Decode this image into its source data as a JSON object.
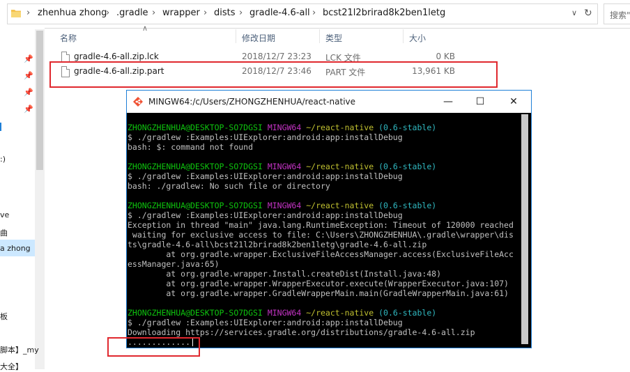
{
  "explorer": {
    "breadcrumbs": [
      "zhenhua zhong",
      ".gradle",
      "wrapper",
      "dists",
      "gradle-4.6-all",
      "bcst21l2brirad8k2ben1letg"
    ],
    "search_placeholder": "搜索\"",
    "columns": {
      "name": "名称",
      "modified": "修改日期",
      "type": "类型",
      "size": "大小"
    },
    "files": [
      {
        "name": "gradle-4.6-all.zip.lck",
        "modified": "2018/12/7 23:23",
        "type": "LCK 文件",
        "size": "0 KB"
      },
      {
        "name": "gradle-4.6-all.zip.part",
        "modified": "2018/12/7 23:46",
        "type": "PART 文件",
        "size": "13,961 KB"
      }
    ],
    "nav_fragments": [
      ":)",
      "ve",
      "曲",
      "a zhong",
      "板",
      "脚本】_my",
      "大全】"
    ]
  },
  "terminal": {
    "title": "MINGW64:/c/Users/ZHONGZHENHUA/react-native",
    "prompt": {
      "user": "ZHONGZHENHUA@DESKTOP-SO7DGSI",
      "env": "MINGW64",
      "path": "~/react-native",
      "branch": "(0.6-stable)"
    },
    "blocks": [
      {
        "command": "$ ./gradlew :Examples:UIExplorer:android:app:installDebug",
        "output": [
          "bash: $: command not found"
        ]
      },
      {
        "command": "$ ./gradlew :Examples:UIExplorer:android:app:installDebug",
        "output": [
          "bash: ./gradlew: No such file or directory"
        ]
      },
      {
        "command": "$ ./gradlew :Examples:UIExplorer:android:app:installDebug",
        "output": [
          "Exception in thread \"main\" java.lang.RuntimeException: Timeout of 120000 reached",
          " waiting for exclusive access to file: C:\\Users\\ZHONGZHENHUA\\.gradle\\wrapper\\dis",
          "ts\\gradle-4.6-all\\bcst21l2brirad8k2ben1letg\\gradle-4.6-all.zip",
          "        at org.gradle.wrapper.ExclusiveFileAccessManager.access(ExclusiveFileAcc",
          "essManager.java:65)",
          "        at org.gradle.wrapper.Install.createDist(Install.java:48)",
          "        at org.gradle.wrapper.WrapperExecutor.execute(WrapperExecutor.java:107)",
          "        at org.gradle.wrapper.GradleWrapperMain.main(GradleWrapperMain.java:61)"
        ]
      },
      {
        "command": "$ ./gradlew :Examples:UIExplorer:android:app:installDebug",
        "output": [
          "Downloading https://services.gradle.org/distributions/gradle-4.6-all.zip",
          "............."
        ]
      }
    ]
  },
  "colors": {
    "highlight": "#e0282e",
    "prompt_user": "#0ec40e",
    "prompt_env": "#c433c4",
    "prompt_path": "#c0c030",
    "prompt_branch": "#30b8c0",
    "terminal_bg": "#000000"
  },
  "icons": [
    "folder-icon",
    "chevron-right-icon",
    "chevron-down-icon",
    "refresh-icon",
    "pin-icon",
    "file-icon",
    "mingw-icon",
    "minimize-icon",
    "maximize-icon",
    "close-icon"
  ]
}
